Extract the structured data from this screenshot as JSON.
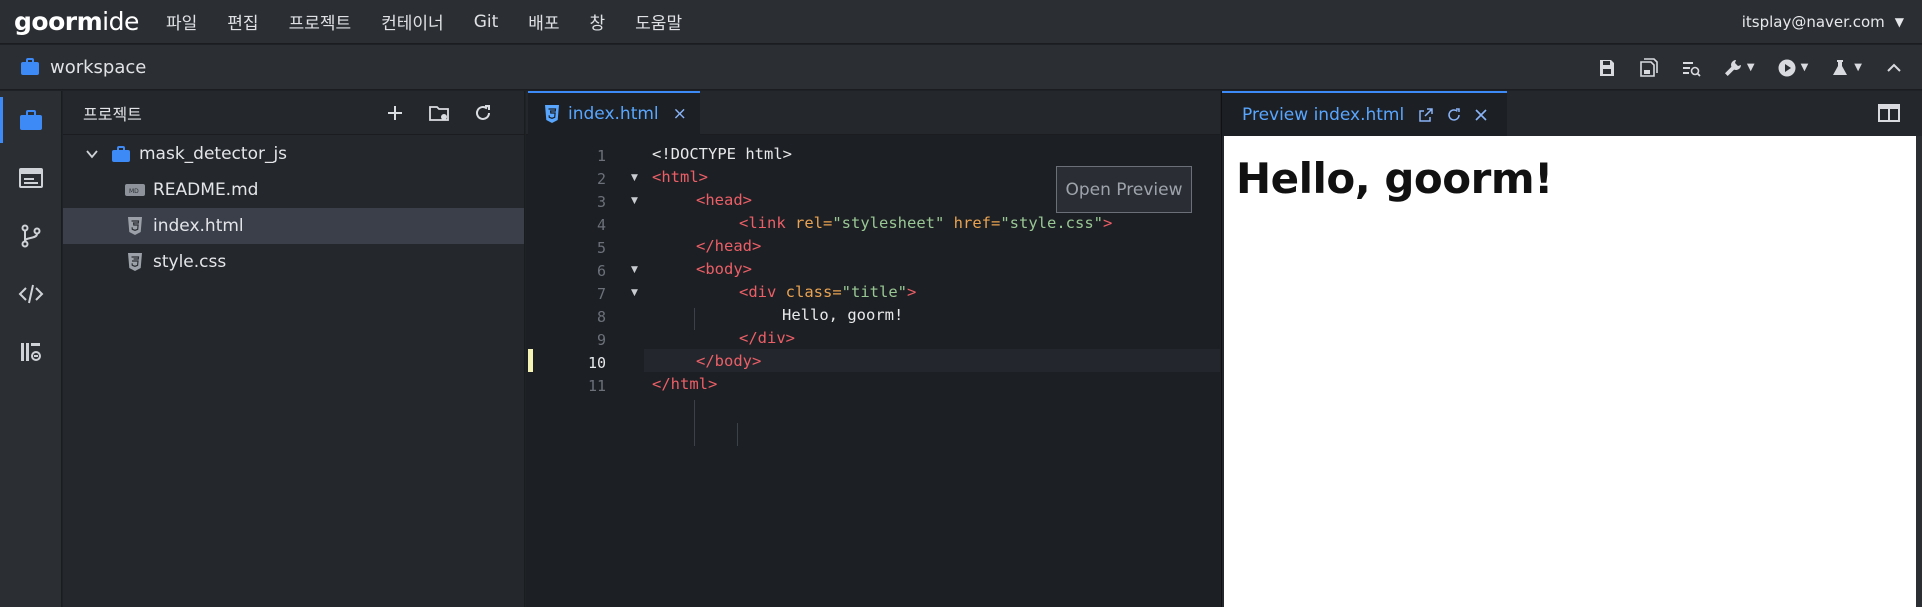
{
  "app": {
    "logo_main": "goorm",
    "logo_sub": "ide",
    "menu": [
      "파일",
      "편집",
      "프로젝트",
      "컨테이너",
      "Git",
      "배포",
      "창",
      "도움말"
    ],
    "user": "itsplay@naver.com"
  },
  "workspace": {
    "name": "workspace"
  },
  "explorer": {
    "title": "프로젝트",
    "root": "mask_detector_js",
    "files": [
      "README.md",
      "index.html",
      "style.css"
    ],
    "selected": "index.html"
  },
  "editor": {
    "tab": "index.html",
    "close": "×",
    "current_line": 10,
    "line_numbers": [
      "1",
      "2",
      "3",
      "4",
      "5",
      "6",
      "7",
      "8",
      "9",
      "10",
      "11"
    ],
    "open_preview": "Open Preview",
    "code": {
      "l1": "<!DOCTYPE html>",
      "l2_open": "<html>",
      "l3_open": "<head>",
      "l4_tag": "<link",
      "l4_attr1": " rel=",
      "l4_val1": "\"stylesheet\"",
      "l4_attr2": " href=",
      "l4_val2": "\"style.css\"",
      "l4_end": ">",
      "l5": "</head>",
      "l6": "<body>",
      "l7_tag": "<div",
      "l7_attr": " class=",
      "l7_val": "\"title\"",
      "l7_end": ">",
      "l8": "Hello, goorm!",
      "l9": "</div>",
      "l10": "</body>",
      "l11": "</html>"
    }
  },
  "preview": {
    "tab": "Preview index.html",
    "content": "Hello, goorm!"
  },
  "colors": {
    "accent": "#3d8af7",
    "tag": "#ec5f67",
    "attr": "#e9a352",
    "string": "#99c794"
  }
}
